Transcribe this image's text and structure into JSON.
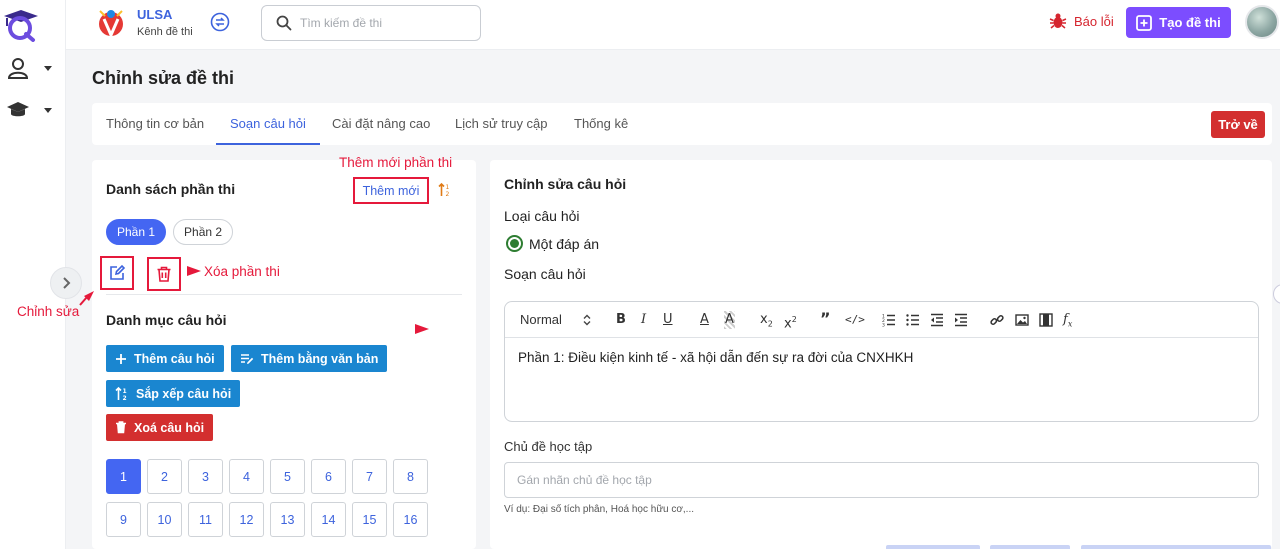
{
  "header": {
    "brand_name": "ULSA",
    "brand_sub": "Kênh đề thi",
    "search_placeholder": "Tìm kiếm đề thi",
    "report_label": "Báo lỗi",
    "create_label": "Tạo đề thi"
  },
  "page": {
    "title": "Chỉnh sửa đề thi"
  },
  "tabs": [
    "Thông tin cơ bản",
    "Soạn câu hỏi",
    "Cài đặt nâng cao",
    "Lịch sử truy cập",
    "Thống kê"
  ],
  "active_tab": "Soạn câu hỏi",
  "back_label": "Trở về",
  "left_panel": {
    "title": "Danh sách phần thi",
    "add_label": "Thêm mới",
    "sections": [
      "Phần 1",
      "Phần 2"
    ],
    "category_title": "Danh mục câu hỏi",
    "actions": {
      "add_question": "Thêm câu hỏi",
      "add_by_text": "Thêm bằng văn bản",
      "sort_questions": "Sắp xếp câu hỏi",
      "delete_questions": "Xoá câu hỏi"
    },
    "question_numbers": [
      "1",
      "2",
      "3",
      "4",
      "5",
      "6",
      "7",
      "8",
      "9",
      "10",
      "11",
      "12",
      "13",
      "14",
      "15",
      "16"
    ]
  },
  "annotations": {
    "add_section": "Thêm mới phần thi",
    "delete_section": "Xóa phần thi",
    "edit": "Chỉnh sửa"
  },
  "right_panel": {
    "title": "Chỉnh sửa câu hỏi",
    "question_type_label": "Loại câu hỏi",
    "question_type_value": "Một đáp án",
    "compose_label": "Soạn câu hỏi",
    "editor": {
      "format_select": "Normal",
      "content": "Phần 1: Điều kiện kinh tế - xã hội dẫn đến sự ra đời của CNXHKH"
    },
    "topic_label": "Chủ đề học tập",
    "topic_placeholder": "Gán nhãn chủ đề học tập",
    "topic_hint": "Ví dụ: Đại số tích phân, Hoá học hữu cơ,..."
  },
  "colors": {
    "primary": "#4466f2",
    "accent_blue": "#1a86d0",
    "danger": "#d32f2f",
    "create_purple": "#7c4dff",
    "annotation_red": "#e5193b"
  }
}
